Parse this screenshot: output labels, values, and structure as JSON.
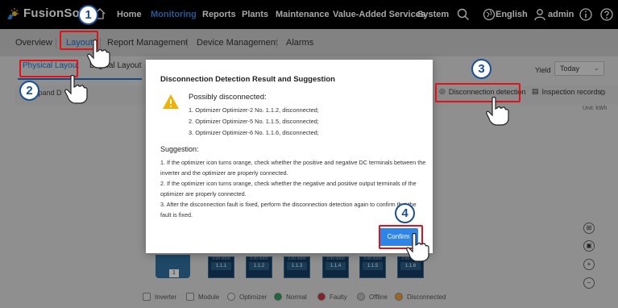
{
  "header": {
    "brand": "FusionSolar",
    "nav": [
      "Home",
      "Monitoring",
      "Reports",
      "Plants",
      "Maintenance",
      "Value-Added Services",
      "System"
    ],
    "active_nav": "Monitoring",
    "language": "English",
    "user": "admin"
  },
  "subnav": {
    "items": [
      "Overview",
      "Layout",
      "Report Management",
      "Device Management",
      "Alarms"
    ],
    "active": "Layout"
  },
  "layout_tabs": {
    "physical": "Physical Layout",
    "logical": "Logical Layout"
  },
  "toolbar": {
    "yield_label": "Yield",
    "yield_value": "Today",
    "expand_label": "Expand D",
    "disconnection_detection": "Disconnection detection",
    "inspection_records": "Inspection records",
    "unit": "Unit: kWh"
  },
  "modules": {
    "inverter_label": "1",
    "items": [
      {
        "label": "1.1.1",
        "value": "2.00 0000"
      },
      {
        "label": "1.1.2",
        "value": "2.00 0000"
      },
      {
        "label": "1.1.3",
        "value": "2.00 0000"
      },
      {
        "label": "1.1.4",
        "value": "2.00 0000"
      },
      {
        "label": "1.1.5",
        "value": "2.00 0000"
      },
      {
        "label": "1.1.6",
        "value": "2.00 0000"
      }
    ]
  },
  "legend": [
    "Inverter",
    "Module",
    "Optimizer",
    "Normal",
    "Faulty",
    "Offline",
    "Disconnected"
  ],
  "dialog": {
    "title": "Disconnection Detection Result and Suggestion",
    "possibly_title": "Possibly disconnected:",
    "items": [
      "1. Optimizer Optimizer-2 No. 1.1.2, disconnected;",
      "2. Optimizer Optimizer-5 No. 1.1.5, disconnected;",
      "3. Optimizer Optimizer-6 No. 1.1.6, disconnected;"
    ],
    "suggestion_title": "Suggestion:",
    "suggestions": [
      "1. If the optimizer icon turns orange, check whether the positive and negative DC terminals between the inverter and the optimizer are properly connected.",
      "2. If the optimizer icon turns orange, check whether the negative and positive output terminals of the optimizer are properly connected.",
      "3. After the disconnection fault is fixed, perform the disconnection detection again to confirm that the fault is fixed."
    ],
    "confirm": "Confirm"
  },
  "annotations": [
    "1",
    "2",
    "3",
    "4"
  ],
  "colors": {
    "accent": "#1f6fd0",
    "annotation_red": "#e0121a",
    "badge_blue": "#1a4f97",
    "confirm_blue": "#2e85e8",
    "warning": "#f2b100"
  }
}
